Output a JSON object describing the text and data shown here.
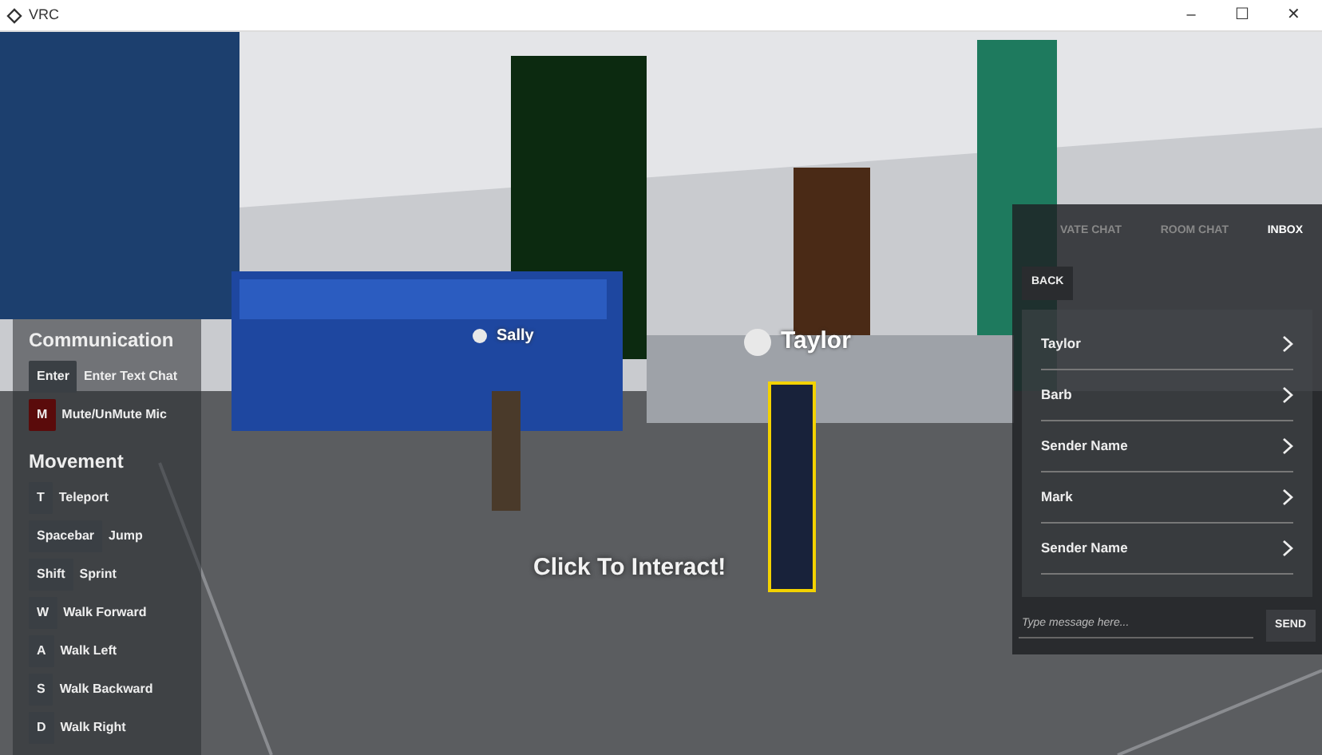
{
  "window": {
    "title": "VRC",
    "controls": [
      "–",
      "☐",
      "✕"
    ]
  },
  "nameplates": [
    {
      "name": "Sally",
      "kind": "small"
    },
    {
      "name": "Taylor",
      "kind": "large"
    }
  ],
  "prompt": "Click To Interact!",
  "controls_panel": {
    "sections": [
      {
        "title": "Communication",
        "keys": [
          {
            "key": "Enter",
            "action": "Enter Text Chat",
            "color": "#3a3f44"
          },
          {
            "key": "M",
            "action": "Mute/UnMute Mic",
            "color": "#5a0b0b"
          }
        ]
      },
      {
        "title": "Movement",
        "keys": [
          {
            "key": "T",
            "action": "Teleport",
            "color": "#3a3f44"
          },
          {
            "key": "Spacebar",
            "action": "Jump",
            "color": "#3a3f44"
          },
          {
            "key": "Shift",
            "action": "Sprint",
            "color": "#3a3f44"
          },
          {
            "key": "W",
            "action": "Walk Forward",
            "color": "#3a3f44"
          },
          {
            "key": "A",
            "action": "Walk Left",
            "color": "#3a3f44"
          },
          {
            "key": "S",
            "action": "Walk Backward",
            "color": "#3a3f44"
          },
          {
            "key": "D",
            "action": "Walk Right",
            "color": "#3a3f44"
          }
        ]
      }
    ]
  },
  "chat_panel": {
    "tabs": [
      {
        "label": "VATE CHAT",
        "selected": false
      },
      {
        "label": "ROOM CHAT",
        "selected": false
      },
      {
        "label": "INBOX",
        "selected": true
      }
    ],
    "back_button": "BACK",
    "inbox": [
      {
        "sender": "Taylor"
      },
      {
        "sender": "Barb"
      },
      {
        "sender": "Sender Name"
      },
      {
        "sender": "Mark"
      },
      {
        "sender": "Sender Name"
      }
    ],
    "message": {
      "placeholder": "Type message here..."
    },
    "send_button": "SEND"
  }
}
